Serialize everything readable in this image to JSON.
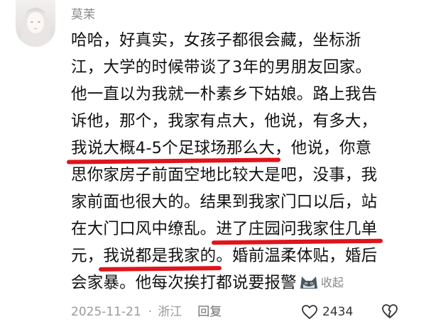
{
  "comment": {
    "username": "莫茉",
    "lines": [
      {
        "pre": "哈哈，好真实，女孩子都很会藏，坐标浙",
        "hl": "",
        "post": ""
      },
      {
        "pre": "江，大学的时候带谈了3年的男朋友回家。",
        "hl": "",
        "post": ""
      },
      {
        "pre": "他一直以为我就一朴素乡下姑娘。路上我告",
        "hl": "",
        "post": ""
      },
      {
        "pre": "诉他，那个，我家有点大，他说，有多大，",
        "hl": "",
        "post": ""
      },
      {
        "pre": "",
        "hl": "我说大概4-5个足球场那么大",
        "post": "，他说，你意"
      },
      {
        "pre": "思你家房子前面空地比较大是吧，没事，我",
        "hl": "",
        "post": ""
      },
      {
        "pre": "家前面也很大的。结果到我家门口以后，站",
        "hl": "",
        "post": ""
      },
      {
        "pre": "在大门口风中缭乱。",
        "hl": "进了庄园问我家住几单",
        "post": ""
      },
      {
        "pre": "元，",
        "hl": "我说都是我家的",
        "post": "。婚前温柔体贴，婚后"
      },
      {
        "pre": "会家暴。他每次挨打都说要报警",
        "hl": "",
        "post": ""
      }
    ],
    "collapse_label": "收起",
    "emoji_icon": "cat-face-icon",
    "highlight_color": "#e0141b",
    "date": "2025-11-21",
    "separator": "·",
    "location": "浙江",
    "reply_label": "回复",
    "like_count": "2434"
  }
}
